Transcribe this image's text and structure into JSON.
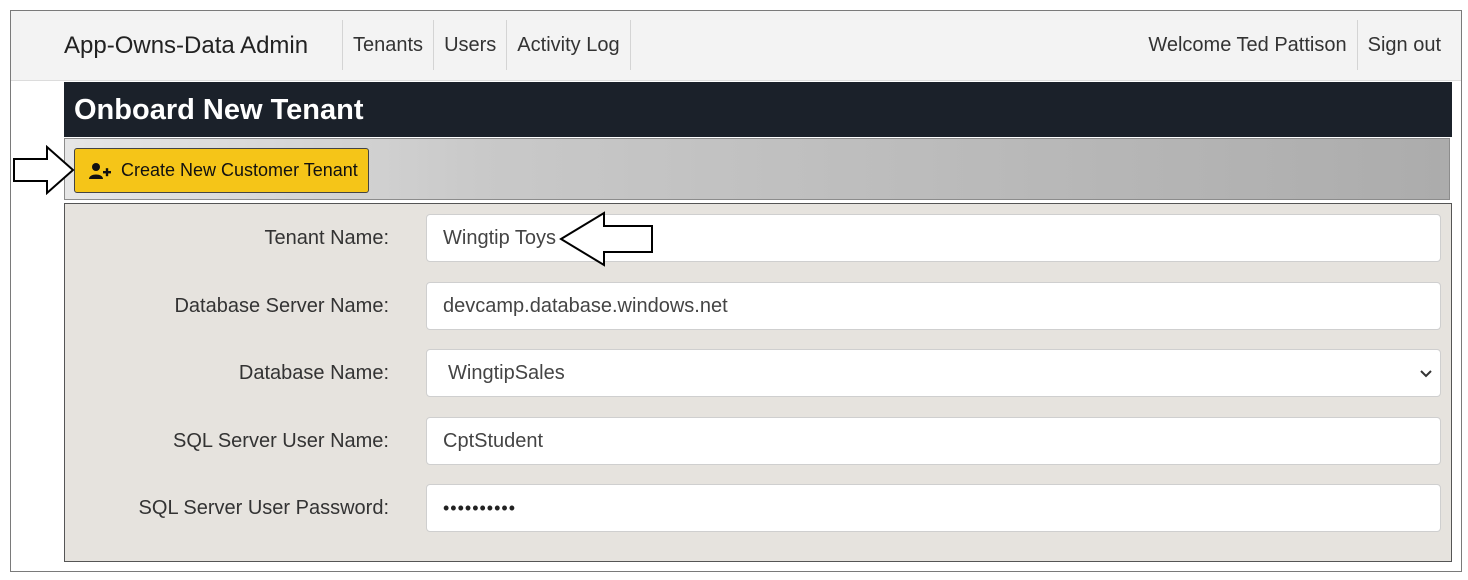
{
  "navbar": {
    "brand": "App-Owns-Data Admin",
    "links": [
      "Tenants",
      "Users",
      "Activity Log"
    ],
    "welcome": "Welcome Ted Pattison",
    "signout": "Sign out"
  },
  "page": {
    "title": "Onboard New Tenant"
  },
  "toolbar": {
    "create_button_label": "Create New Customer Tenant",
    "create_button_icon": "user-plus-icon",
    "button_color": "#f5c518"
  },
  "form": {
    "tenant_name": {
      "label": "Tenant Name:",
      "value": "Wingtip Toys"
    },
    "db_server": {
      "label": "Database Server Name:",
      "value": "devcamp.database.windows.net"
    },
    "db_name": {
      "label": "Database Name:",
      "value": "WingtipSales"
    },
    "sql_user": {
      "label": "SQL Server User Name:",
      "value": "CptStudent"
    },
    "sql_password": {
      "label": "SQL Server User Password:",
      "value": "••••••••••"
    }
  },
  "colors": {
    "title_bar": "#1b212a",
    "form_bg": "#e6e3de",
    "navbar_bg": "#f3f3f3"
  }
}
